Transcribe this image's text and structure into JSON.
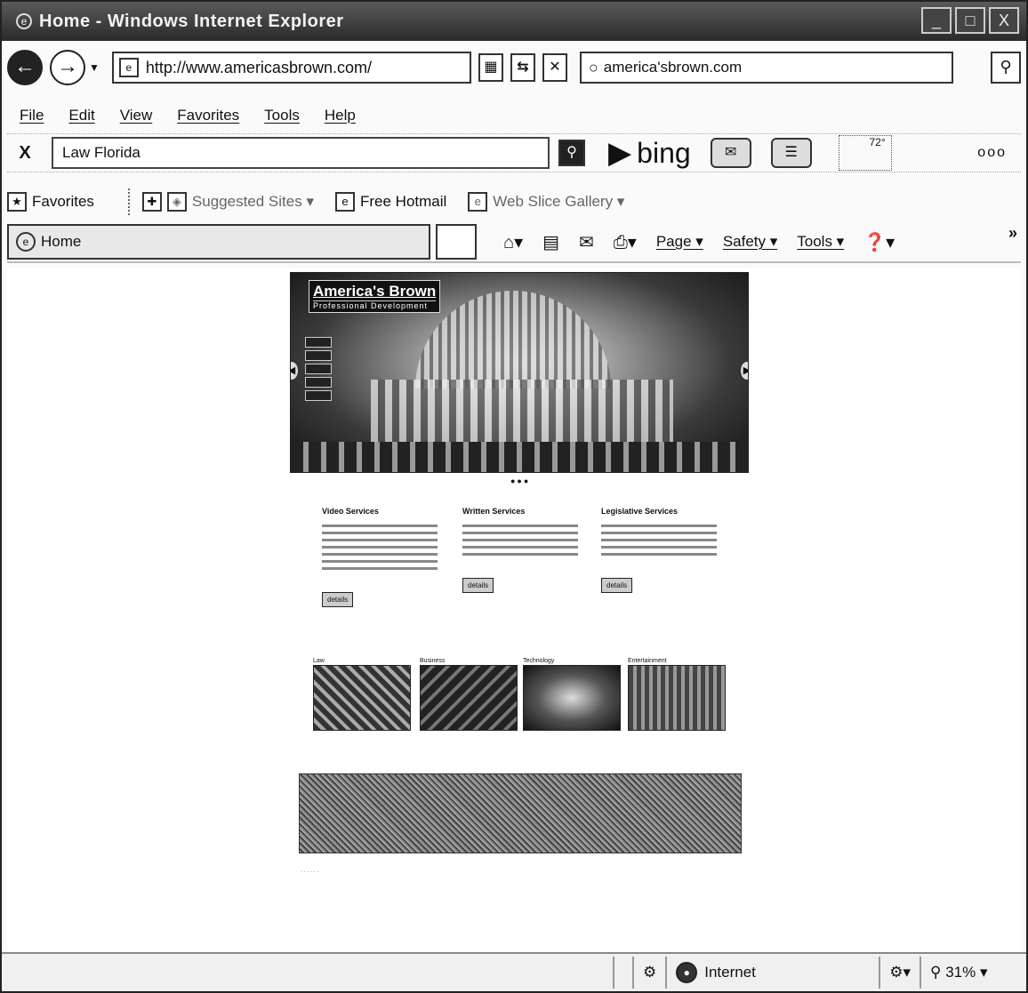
{
  "window": {
    "title": "Home - Windows Internet Explorer",
    "buttons": [
      "_",
      "□",
      "X"
    ]
  },
  "address": {
    "url": "http://www.americasbrown.com/",
    "search_value": "america'sbrown.com"
  },
  "menu": [
    "File",
    "Edit",
    "View",
    "Favorites",
    "Tools",
    "Help"
  ],
  "bing_bar": {
    "close": "X",
    "query": "Law Florida",
    "logo_text": "bing",
    "weather_temp": "72°",
    "more": "ooo"
  },
  "favorites_bar": {
    "favorites_label": "Favorites",
    "items": [
      "Suggested Sites ▾",
      "Free Hotmail",
      "Web Slice Gallery ▾"
    ]
  },
  "command_bar": {
    "tab_label": "Home",
    "commands": [
      "Page ▾",
      "Safety ▾",
      "Tools ▾"
    ],
    "chevron": "»"
  },
  "page": {
    "brand_name": "America's Brown",
    "brand_sub": "Professional Development",
    "services": [
      {
        "title": "Video Services",
        "button": "details"
      },
      {
        "title": "Written Services",
        "button": "details"
      },
      {
        "title": "Legislative Services",
        "button": "details"
      }
    ],
    "thumbnails": [
      "Law",
      "Business",
      "Technology",
      "Entertainment"
    ]
  },
  "status_bar": {
    "zone": "Internet",
    "zoom": "31%"
  }
}
